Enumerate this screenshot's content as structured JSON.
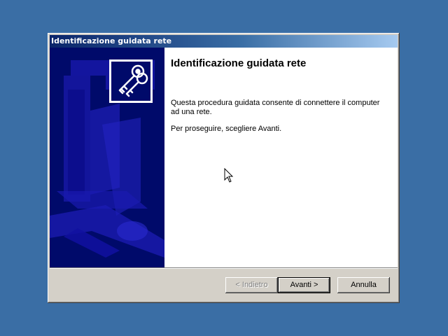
{
  "window": {
    "title": "Identificazione guidata rete"
  },
  "wizard": {
    "heading": "Identificazione guidata rete",
    "description": "Questa procedura guidata consente di connettere il computer ad una rete.",
    "hint": "Per proseguire, scegliere Avanti.",
    "icon": "keys-icon"
  },
  "buttons": {
    "back": "< Indietro",
    "next": "Avanti >",
    "cancel": "Annulla"
  },
  "colors": {
    "desktop": "#3a6ea5",
    "side_panel": "#000a6a",
    "title_start": "#0a246a",
    "title_end": "#a6caf0"
  }
}
